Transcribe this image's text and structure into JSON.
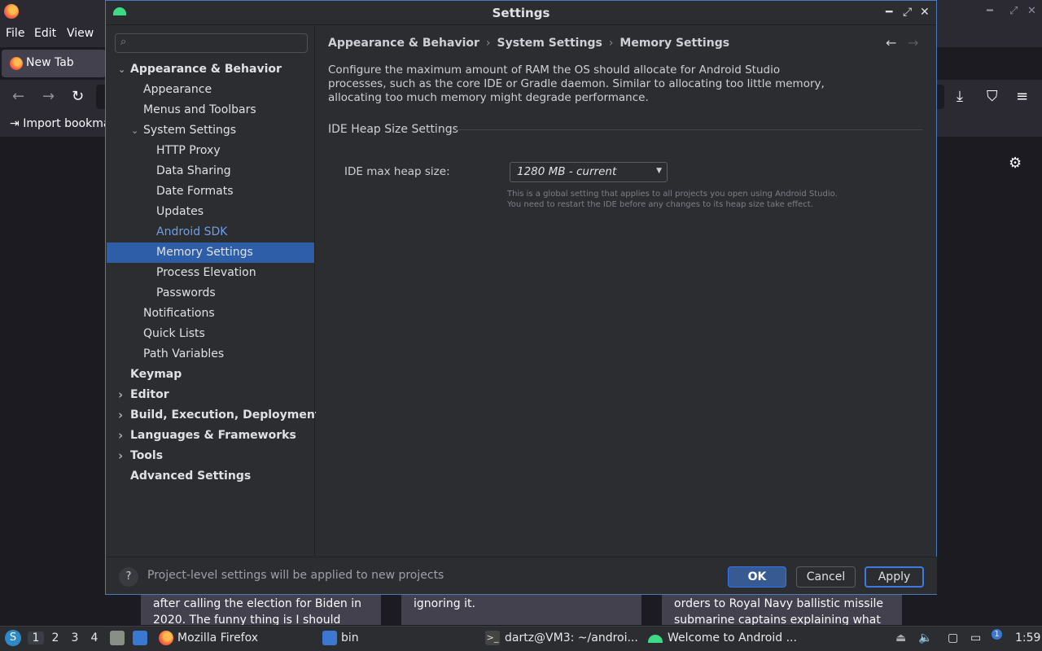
{
  "firefox": {
    "menu": [
      "File",
      "Edit",
      "View"
    ],
    "tab_label": "New Tab",
    "bookmark_label": "Import bookmarks...",
    "stories": [
      "after calling the election for Biden in 2020. The funny thing is I should have...",
      "ignoring it.",
      "orders to Royal Navy ballistic missile submarine captains explaining what to ..."
    ]
  },
  "taskbar": {
    "workspaces": [
      "1",
      "2",
      "3",
      "4"
    ],
    "apps": [
      "Mozilla Firefox",
      "bin",
      "dartz@VM3: ~/androi...",
      "Welcome to Android ..."
    ],
    "clock": "1:59",
    "notification_count": "1"
  },
  "dialog": {
    "title": "Settings",
    "search_placeholder": "",
    "tree": [
      {
        "label": "Appearance & Behavior",
        "level": 0,
        "bold": true,
        "expanded": true
      },
      {
        "label": "Appearance",
        "level": 1
      },
      {
        "label": "Menus and Toolbars",
        "level": 1
      },
      {
        "label": "System Settings",
        "level": 1,
        "expanded": true
      },
      {
        "label": "HTTP Proxy",
        "level": 2
      },
      {
        "label": "Data Sharing",
        "level": 2
      },
      {
        "label": "Date Formats",
        "level": 2
      },
      {
        "label": "Updates",
        "level": 2
      },
      {
        "label": "Android SDK",
        "level": 2,
        "link": true
      },
      {
        "label": "Memory Settings",
        "level": 2,
        "selected": true
      },
      {
        "label": "Process Elevation",
        "level": 2
      },
      {
        "label": "Passwords",
        "level": 2
      },
      {
        "label": "Notifications",
        "level": 1
      },
      {
        "label": "Quick Lists",
        "level": 1
      },
      {
        "label": "Path Variables",
        "level": 1
      },
      {
        "label": "Keymap",
        "level": 0,
        "bold": true
      },
      {
        "label": "Editor",
        "level": 0,
        "bold": true,
        "collapsed": true
      },
      {
        "label": "Build, Execution, Deployment",
        "level": 0,
        "bold": true,
        "collapsed": true
      },
      {
        "label": "Languages & Frameworks",
        "level": 0,
        "bold": true,
        "collapsed": true
      },
      {
        "label": "Tools",
        "level": 0,
        "bold": true,
        "collapsed": true
      },
      {
        "label": "Advanced Settings",
        "level": 0,
        "bold": true
      }
    ],
    "breadcrumb": [
      "Appearance & Behavior",
      "System Settings",
      "Memory Settings"
    ],
    "description": "Configure the maximum amount of RAM the OS should allocate for Android Studio processes, such as the core IDE or Gradle daemon. Similar to allocating too little memory, allocating too much memory might degrade performance.",
    "section_title": "IDE Heap Size Settings",
    "heap_label": "IDE max heap size:",
    "heap_value": "1280 MB - current",
    "hint_line1": "This is a global setting that applies to all projects you open using Android Studio.",
    "hint_line2": "You need to restart the IDE before any changes to its heap size take effect.",
    "footer_text": "Project-level settings will be applied to new projects",
    "buttons": {
      "ok": "OK",
      "cancel": "Cancel",
      "apply": "Apply"
    }
  },
  "colors": {
    "selection": "#2e5ea8",
    "link": "#6e9fe6",
    "dialog_bg": "#2b2d30",
    "border_accent": "#4a7bc0"
  }
}
